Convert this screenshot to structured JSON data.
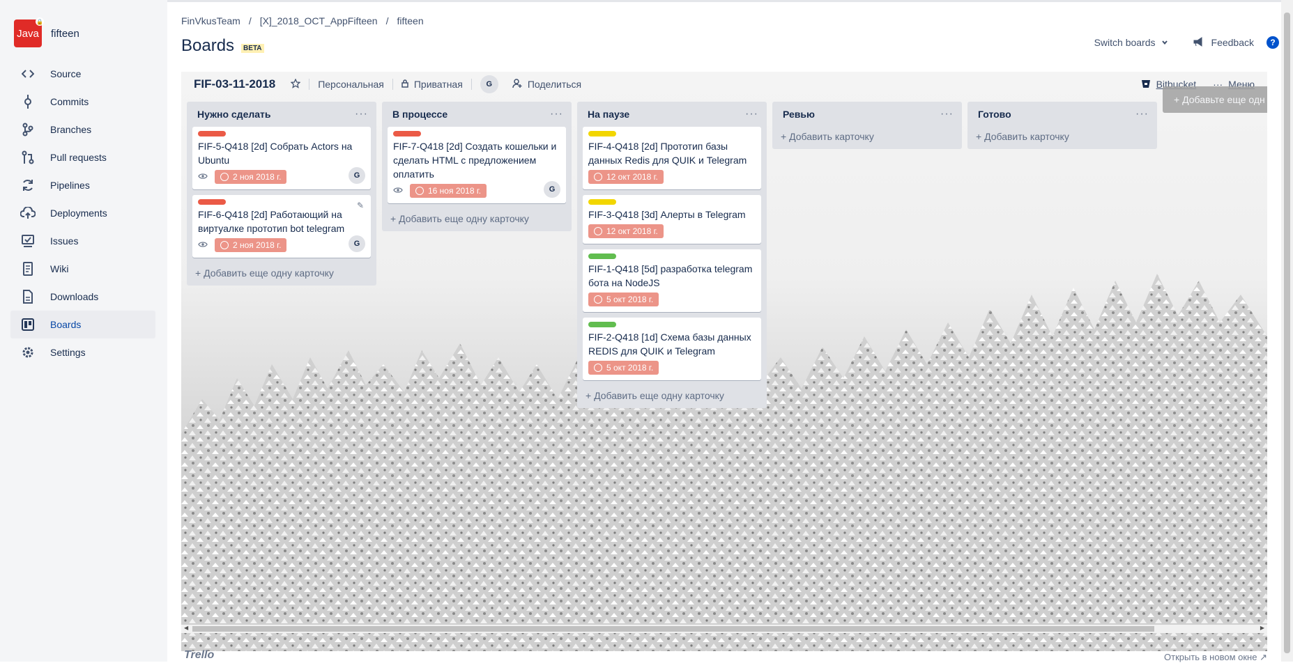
{
  "sidebar": {
    "repo_logo_text": "Java",
    "repo_name": "fifteen",
    "items": [
      {
        "label": "Source",
        "icon": "code-icon"
      },
      {
        "label": "Commits",
        "icon": "commit-icon"
      },
      {
        "label": "Branches",
        "icon": "branch-icon"
      },
      {
        "label": "Pull requests",
        "icon": "pull-request-icon"
      },
      {
        "label": "Pipelines",
        "icon": "pipelines-icon"
      },
      {
        "label": "Deployments",
        "icon": "cloud-upload-icon"
      },
      {
        "label": "Issues",
        "icon": "issues-icon"
      },
      {
        "label": "Wiki",
        "icon": "wiki-icon"
      },
      {
        "label": "Downloads",
        "icon": "downloads-icon"
      },
      {
        "label": "Boards",
        "icon": "boards-icon",
        "active": true
      },
      {
        "label": "Settings",
        "icon": "gear-icon"
      }
    ]
  },
  "header": {
    "breadcrumbs": [
      "FinVkusTeam",
      "[X]_2018_OCT_AppFifteen",
      "fifteen"
    ],
    "separator": "/",
    "title": "Boards",
    "beta": "BETA",
    "switch_boards": "Switch boards",
    "feedback": "Feedback",
    "help": "?"
  },
  "board": {
    "name": "FIF-03-11-2018",
    "team": "Персональная",
    "visibility": "Приватная",
    "member_initial": "G",
    "share": "Поделиться",
    "bitbucket": "Bitbucket",
    "menu": "Меню",
    "add_list": "+ Добавьте еще одн"
  },
  "lists": [
    {
      "title": "Нужно сделать",
      "menu": "···",
      "add_card": "+ Добавить еще одну карточку",
      "cards": [
        {
          "label_color": "#eb5a46",
          "title": "FIF-5-Q418 [2d] Собрать Actors на Ubuntu",
          "due": "2 ноя 2018 г.",
          "watch": true,
          "member": "G"
        },
        {
          "label_color": "#eb5a46",
          "title": "FIF-6-Q418 [2d] Работающий на виртуалке прототип bot telegram",
          "due": "2 ноя 2018 г.",
          "watch": true,
          "member": "G",
          "edit": true
        }
      ]
    },
    {
      "title": "В процессе",
      "menu": "···",
      "add_card": "+ Добавить еще одну карточку",
      "cards": [
        {
          "label_color": "#eb5a46",
          "title": "FIF-7-Q418 [2d] Создать кошельки и сделать HTML с предложением оплатить",
          "due": "16 ноя 2018 г.",
          "watch": true,
          "member": "G"
        }
      ]
    },
    {
      "title": "На паузе",
      "menu": "···",
      "add_card": "+ Добавить еще одну карточку",
      "cards": [
        {
          "label_color": "#f2d600",
          "title": "FIF-4-Q418 [2d] Прототип базы данных Redis для QUIK и Telegram",
          "due": "12 окт 2018 г."
        },
        {
          "label_color": "#f2d600",
          "title": "FIF-3-Q418 [3d] Алерты в Telegram",
          "due": "12 окт 2018 г."
        },
        {
          "label_color": "#61bd4f",
          "title": "FIF-1-Q418 [5d] разработка telegram бота на NodeJS",
          "due": "5 окт 2018 г."
        },
        {
          "label_color": "#61bd4f",
          "title": "FIF-2-Q418 [1d] Схема базы данных REDIS для QUIK и Telegram",
          "due": "5 окт 2018 г."
        }
      ]
    },
    {
      "title": "Ревью",
      "menu": "···",
      "add_card": "+ Добавить карточку",
      "cards": []
    },
    {
      "title": "Готово",
      "menu": "···",
      "add_card": "+ Добавить карточку",
      "cards": []
    }
  ],
  "footer": {
    "trello": "Trello",
    "open_new_window": "Открыть в новом окне"
  },
  "colors": {
    "accent": "#0052cc",
    "due_badge": "#ec9488",
    "list_bg": "#dfe1e6"
  }
}
